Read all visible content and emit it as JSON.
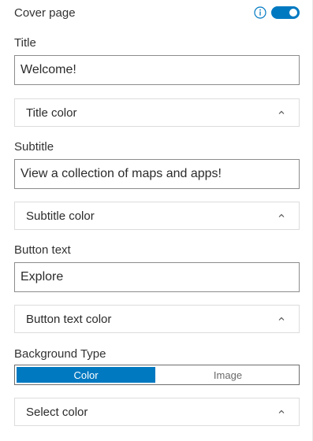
{
  "cover": {
    "label": "Cover page",
    "toggle_on": true,
    "accent_color": "#0079c1"
  },
  "title_field": {
    "label": "Title",
    "value": "Welcome!"
  },
  "title_color": {
    "label": "Title color"
  },
  "subtitle_field": {
    "label": "Subtitle",
    "value": "View a collection of maps and apps!"
  },
  "subtitle_color": {
    "label": "Subtitle color"
  },
  "button_text_field": {
    "label": "Button text",
    "value": "Explore"
  },
  "button_text_color": {
    "label": "Button text color"
  },
  "background_type": {
    "label": "Background Type",
    "options": [
      "Color",
      "Image"
    ],
    "selected": "Color"
  },
  "select_color": {
    "label": "Select color"
  },
  "icons": {
    "info": "info-icon",
    "chevron": "chevron-up-icon"
  }
}
